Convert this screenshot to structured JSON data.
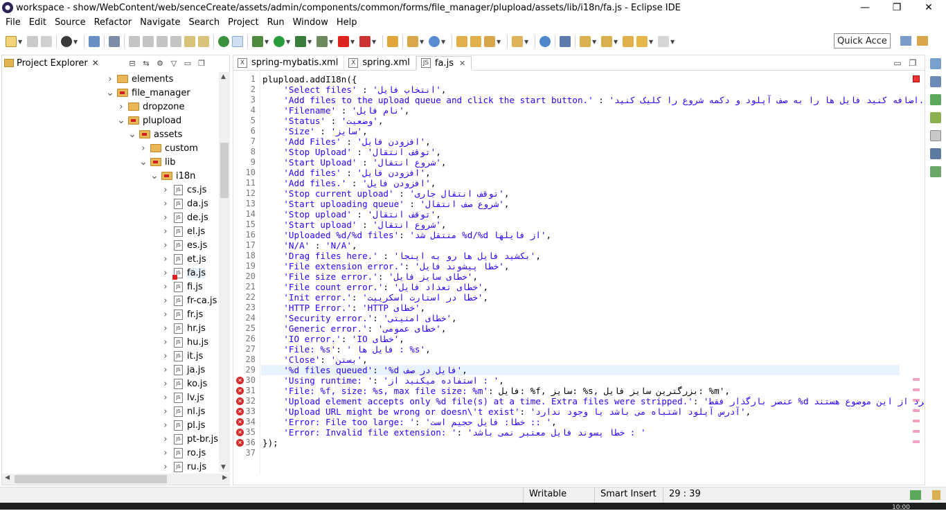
{
  "window": {
    "title": "workspace - show/WebContent/web/senceCreate/assets/admin/components/common/forms/file_manager/plupload/assets/lib/i18n/fa.js - Eclipse IDE",
    "minimize": "—",
    "maximize": "❐",
    "close": "✕"
  },
  "menu": [
    "File",
    "Edit",
    "Source",
    "Refactor",
    "Navigate",
    "Search",
    "Project",
    "Run",
    "Window",
    "Help"
  ],
  "quick_access": "Quick Access",
  "explorer": {
    "title": "Project Explorer",
    "close": "✕",
    "tree": [
      {
        "label": "elements",
        "type": "folder",
        "depth": 1,
        "open": false
      },
      {
        "label": "file_manager",
        "type": "pkg",
        "depth": 1,
        "open": true
      },
      {
        "label": "dropzone",
        "type": "folder",
        "depth": 2,
        "open": false
      },
      {
        "label": "plupload",
        "type": "pkg",
        "depth": 2,
        "open": true
      },
      {
        "label": "assets",
        "type": "pkg",
        "depth": 3,
        "open": true
      },
      {
        "label": "custom",
        "type": "folder",
        "depth": 4,
        "open": false
      },
      {
        "label": "lib",
        "type": "pkg",
        "depth": 4,
        "open": true
      },
      {
        "label": "i18n",
        "type": "pkg",
        "depth": 5,
        "open": true
      },
      {
        "label": "cs.js",
        "type": "js",
        "depth": 6
      },
      {
        "label": "da.js",
        "type": "js",
        "depth": 6
      },
      {
        "label": "de.js",
        "type": "js",
        "depth": 6
      },
      {
        "label": "el.js",
        "type": "js",
        "depth": 6
      },
      {
        "label": "es.js",
        "type": "js",
        "depth": 6
      },
      {
        "label": "et.js",
        "type": "js",
        "depth": 6
      },
      {
        "label": "fa.js",
        "type": "jserr",
        "depth": 6,
        "selected": true
      },
      {
        "label": "fi.js",
        "type": "js",
        "depth": 6
      },
      {
        "label": "fr-ca.js",
        "type": "js",
        "depth": 6
      },
      {
        "label": "fr.js",
        "type": "js",
        "depth": 6
      },
      {
        "label": "hr.js",
        "type": "js",
        "depth": 6
      },
      {
        "label": "hu.js",
        "type": "js",
        "depth": 6
      },
      {
        "label": "it.js",
        "type": "js",
        "depth": 6
      },
      {
        "label": "ja.js",
        "type": "js",
        "depth": 6
      },
      {
        "label": "ko.js",
        "type": "js",
        "depth": 6
      },
      {
        "label": "lv.js",
        "type": "js",
        "depth": 6
      },
      {
        "label": "nl.js",
        "type": "js",
        "depth": 6
      },
      {
        "label": "pl.js",
        "type": "js",
        "depth": 6
      },
      {
        "label": "pt-br.js",
        "type": "js",
        "depth": 6
      },
      {
        "label": "ro.js",
        "type": "js",
        "depth": 6
      },
      {
        "label": "ru.js",
        "type": "js",
        "depth": 6
      }
    ]
  },
  "editor": {
    "tabs": [
      {
        "label": "spring-mybatis.xml",
        "active": false
      },
      {
        "label": "spring.xml",
        "active": false
      },
      {
        "label": "fa.js",
        "active": true
      }
    ],
    "current_line": 29,
    "error_lines": [
      30,
      31,
      32,
      33,
      34,
      35,
      36
    ],
    "lines": [
      [
        {
          "t": "plupload.addI18n({",
          "s": false
        }
      ],
      [
        {
          "t": "    ",
          "s": false
        },
        {
          "t": "'Select files'",
          "s": true
        },
        {
          "t": " : ",
          "s": false
        },
        {
          "t": "'انتخاب فایل'",
          "s": true
        },
        {
          "t": ",",
          "s": false
        }
      ],
      [
        {
          "t": "    ",
          "s": false
        },
        {
          "t": "'Add files to the upload queue and click the start button.'",
          "s": true
        },
        {
          "t": " : ",
          "s": false
        },
        {
          "t": "'اضافه کنید فایل ها را به صف آپلود و دکمه شروع را کلیک کنید.'",
          "s": true
        },
        {
          "t": ",",
          "s": false
        }
      ],
      [
        {
          "t": "    ",
          "s": false
        },
        {
          "t": "'Filename'",
          "s": true
        },
        {
          "t": " : ",
          "s": false
        },
        {
          "t": "'نام فایل'",
          "s": true
        },
        {
          "t": ",",
          "s": false
        }
      ],
      [
        {
          "t": "    ",
          "s": false
        },
        {
          "t": "'Status'",
          "s": true
        },
        {
          "t": " : ",
          "s": false
        },
        {
          "t": "'وضعیت'",
          "s": true
        },
        {
          "t": ",",
          "s": false
        }
      ],
      [
        {
          "t": "    ",
          "s": false
        },
        {
          "t": "'Size'",
          "s": true
        },
        {
          "t": " : ",
          "s": false
        },
        {
          "t": "'سایز'",
          "s": true
        },
        {
          "t": ",",
          "s": false
        }
      ],
      [
        {
          "t": "    ",
          "s": false
        },
        {
          "t": "'Add Files'",
          "s": true
        },
        {
          "t": " : ",
          "s": false
        },
        {
          "t": "'افزودن فایل'",
          "s": true
        },
        {
          "t": ",",
          "s": false
        }
      ],
      [
        {
          "t": "    ",
          "s": false
        },
        {
          "t": "'Stop Upload'",
          "s": true
        },
        {
          "t": " : ",
          "s": false
        },
        {
          "t": "'توقف انتقال'",
          "s": true
        },
        {
          "t": ",",
          "s": false
        }
      ],
      [
        {
          "t": "    ",
          "s": false
        },
        {
          "t": "'Start Upload'",
          "s": true
        },
        {
          "t": " : ",
          "s": false
        },
        {
          "t": "'شروع انتقال'",
          "s": true
        },
        {
          "t": ",",
          "s": false
        }
      ],
      [
        {
          "t": "    ",
          "s": false
        },
        {
          "t": "'Add files'",
          "s": true
        },
        {
          "t": " : ",
          "s": false
        },
        {
          "t": "'افزودن فایل'",
          "s": true
        },
        {
          "t": ",",
          "s": false
        }
      ],
      [
        {
          "t": "    ",
          "s": false
        },
        {
          "t": "'Add files.'",
          "s": true
        },
        {
          "t": " : ",
          "s": false
        },
        {
          "t": "'افزودن فایل'",
          "s": true
        },
        {
          "t": ",",
          "s": false
        }
      ],
      [
        {
          "t": "    ",
          "s": false
        },
        {
          "t": "'Stop current upload'",
          "s": true
        },
        {
          "t": " : ",
          "s": false
        },
        {
          "t": "'توقف انتقال جاری'",
          "s": true
        },
        {
          "t": ",",
          "s": false
        }
      ],
      [
        {
          "t": "    ",
          "s": false
        },
        {
          "t": "'Start uploading queue'",
          "s": true
        },
        {
          "t": " : ",
          "s": false
        },
        {
          "t": "'شروع صف انتقال'",
          "s": true
        },
        {
          "t": ",",
          "s": false
        }
      ],
      [
        {
          "t": "    ",
          "s": false
        },
        {
          "t": "'Stop upload'",
          "s": true
        },
        {
          "t": " : ",
          "s": false
        },
        {
          "t": "'توقف انتقال'",
          "s": true
        },
        {
          "t": ",",
          "s": false
        }
      ],
      [
        {
          "t": "    ",
          "s": false
        },
        {
          "t": "'Start upload'",
          "s": true
        },
        {
          "t": " : ",
          "s": false
        },
        {
          "t": "'شروع انتقال'",
          "s": true
        },
        {
          "t": ",",
          "s": false
        }
      ],
      [
        {
          "t": "    ",
          "s": false
        },
        {
          "t": "'Uploaded %d/%d files'",
          "s": true
        },
        {
          "t": ": ",
          "s": false
        },
        {
          "t": "'منتقل شد %d/%d از فایلها'",
          "s": true
        },
        {
          "t": ",",
          "s": false
        }
      ],
      [
        {
          "t": "    ",
          "s": false
        },
        {
          "t": "'N/A'",
          "s": true
        },
        {
          "t": " : ",
          "s": false
        },
        {
          "t": "'N/A'",
          "s": true
        },
        {
          "t": ",",
          "s": false
        }
      ],
      [
        {
          "t": "    ",
          "s": false
        },
        {
          "t": "'Drag files here.'",
          "s": true
        },
        {
          "t": " : ",
          "s": false
        },
        {
          "t": "'بکشید فایل ها رو به اینجا'",
          "s": true
        },
        {
          "t": ",",
          "s": false
        }
      ],
      [
        {
          "t": "    ",
          "s": false
        },
        {
          "t": "'File extension error.'",
          "s": true
        },
        {
          "t": ": ",
          "s": false
        },
        {
          "t": "'خطا پیشوند فایل'",
          "s": true
        },
        {
          "t": ",",
          "s": false
        }
      ],
      [
        {
          "t": "    ",
          "s": false
        },
        {
          "t": "'File size error.'",
          "s": true
        },
        {
          "t": ": ",
          "s": false
        },
        {
          "t": "'خطای سایز فایل'",
          "s": true
        },
        {
          "t": ",",
          "s": false
        }
      ],
      [
        {
          "t": "    ",
          "s": false
        },
        {
          "t": "'File count error.'",
          "s": true
        },
        {
          "t": ": ",
          "s": false
        },
        {
          "t": "'خطای تعداد فایل'",
          "s": true
        },
        {
          "t": ",",
          "s": false
        }
      ],
      [
        {
          "t": "    ",
          "s": false
        },
        {
          "t": "'Init error.'",
          "s": true
        },
        {
          "t": ": ",
          "s": false
        },
        {
          "t": "'خطا در استارت اسکریپت'",
          "s": true
        },
        {
          "t": ",",
          "s": false
        }
      ],
      [
        {
          "t": "    ",
          "s": false
        },
        {
          "t": "'HTTP Error.'",
          "s": true
        },
        {
          "t": ": ",
          "s": false
        },
        {
          "t": "'HTTP خطای'",
          "s": true
        },
        {
          "t": ",",
          "s": false
        }
      ],
      [
        {
          "t": "    ",
          "s": false
        },
        {
          "t": "'Security error.'",
          "s": true
        },
        {
          "t": ": ",
          "s": false
        },
        {
          "t": "'خطای امنیتی'",
          "s": true
        },
        {
          "t": ",",
          "s": false
        }
      ],
      [
        {
          "t": "    ",
          "s": false
        },
        {
          "t": "'Generic error.'",
          "s": true
        },
        {
          "t": ": ",
          "s": false
        },
        {
          "t": "'خطای عمومی'",
          "s": true
        },
        {
          "t": ",",
          "s": false
        }
      ],
      [
        {
          "t": "    ",
          "s": false
        },
        {
          "t": "'IO error.'",
          "s": true
        },
        {
          "t": ": ",
          "s": false
        },
        {
          "t": "'IO خطای'",
          "s": true
        },
        {
          "t": ",",
          "s": false
        }
      ],
      [
        {
          "t": "    ",
          "s": false
        },
        {
          "t": "'File: %s'",
          "s": true
        },
        {
          "t": ": ",
          "s": false
        },
        {
          "t": "' فایل ها : %s'",
          "s": true
        },
        {
          "t": ",",
          "s": false
        }
      ],
      [
        {
          "t": "    ",
          "s": false
        },
        {
          "t": "'Close'",
          "s": true
        },
        {
          "t": ": ",
          "s": false
        },
        {
          "t": "'بستن'",
          "s": true
        },
        {
          "t": ",",
          "s": false
        }
      ],
      [
        {
          "t": "    ",
          "s": false
        },
        {
          "t": "'%d files queued'",
          "s": true
        },
        {
          "t": ": ",
          "s": false
        },
        {
          "t": "'%d فایل در صف'",
          "s": true
        },
        {
          "t": ",",
          "s": false
        }
      ],
      [
        {
          "t": "    ",
          "s": false
        },
        {
          "t": "'Using runtime: '",
          "s": true
        },
        {
          "t": ": ",
          "s": false
        },
        {
          "t": "'استفاده میکنید از : '",
          "s": true
        },
        {
          "t": ",",
          "s": false
        }
      ],
      [
        {
          "t": "    ",
          "s": false
        },
        {
          "t": "'File: %f, size: %s, max file size: %m'",
          "s": true
        },
        {
          "t": ": ",
          "s": false
        },
        {
          "t": "فایل: %f, سایز: %s, بزرگترین سایز فایل: %m",
          "s": false
        },
        {
          "t": "',",
          "s": false
        }
      ],
      [
        {
          "t": "    ",
          "s": false
        },
        {
          "t": "'Upload element accepts only %d file(s) at a time. Extra files were stripped.'",
          "s": true
        },
        {
          "t": ": ",
          "s": false
        },
        {
          "t": "'عنصر بارگذار فقط %d فایل رو در یک زمان می پذیرد. سایر فایل ها مجرد از این موضوع هستند.'",
          "s": true
        },
        {
          "t": ",",
          "s": false
        }
      ],
      [
        {
          "t": "    ",
          "s": false
        },
        {
          "t": "'Upload URL might be wrong or doesn\\'t exist'",
          "s": true
        },
        {
          "t": ": ",
          "s": false
        },
        {
          "t": "'آدرس آپلود اشتباه می باشد یا وجود ندارد'",
          "s": true
        },
        {
          "t": ",",
          "s": false
        }
      ],
      [
        {
          "t": "    ",
          "s": false
        },
        {
          "t": "'Error: File too large: '",
          "s": true
        },
        {
          "t": ": ",
          "s": false
        },
        {
          "t": "'خطا: فایل حجیم است :: '",
          "s": true
        },
        {
          "t": ",",
          "s": false
        }
      ],
      [
        {
          "t": "    ",
          "s": false
        },
        {
          "t": "'Error: Invalid file extension: '",
          "s": true
        },
        {
          "t": ": ",
          "s": false
        },
        {
          "t": "'خطا پسوند فایل معتبر نمی باشد : '",
          "s": true
        }
      ],
      [
        {
          "t": "});",
          "s": false
        }
      ],
      [
        {
          "t": "",
          "s": false
        }
      ]
    ]
  },
  "status": {
    "writable": "Writable",
    "insert_mode": "Smart Insert",
    "position": "29 : 39"
  },
  "taskbar_clock": "10:00"
}
